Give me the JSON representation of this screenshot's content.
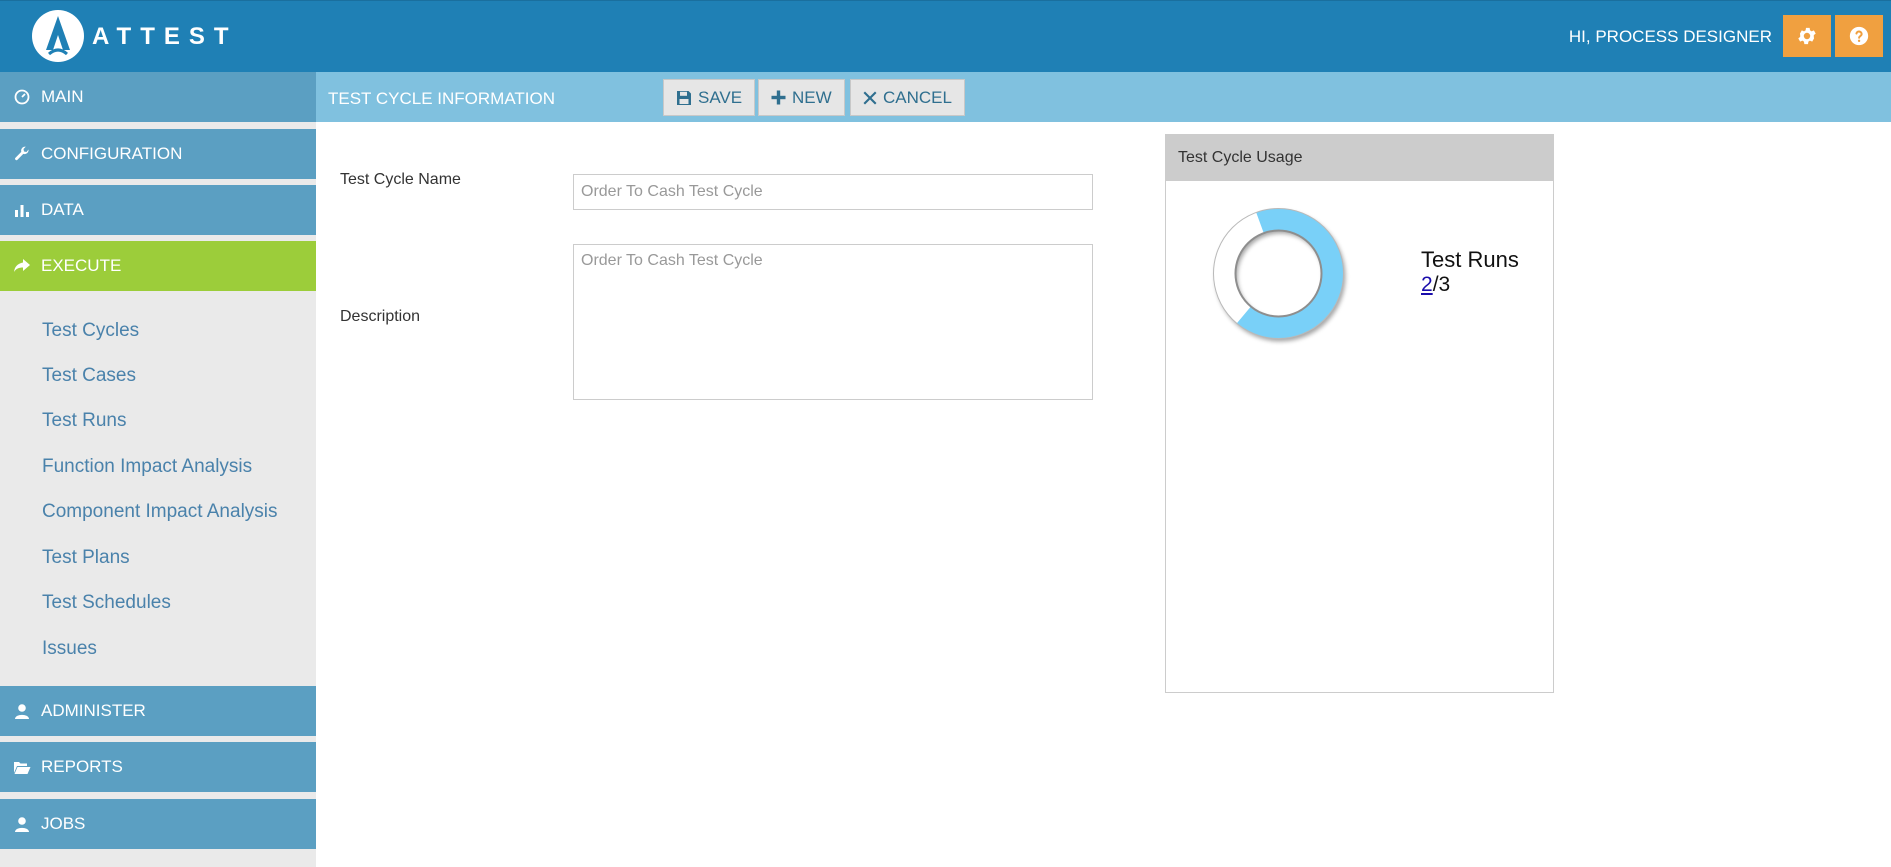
{
  "app": {
    "logo_text": "ATTEST"
  },
  "header": {
    "greeting": "HI, PROCESS DESIGNER"
  },
  "sidebar": {
    "sections": [
      {
        "label": "MAIN",
        "icon": "dashboard-icon"
      },
      {
        "label": "CONFIGURATION",
        "icon": "wrench-icon"
      },
      {
        "label": "DATA",
        "icon": "bar-chart-icon"
      },
      {
        "label": "EXECUTE",
        "icon": "share-arrow-icon",
        "active": true
      },
      {
        "label": "ADMINISTER",
        "icon": "user-icon"
      },
      {
        "label": "REPORTS",
        "icon": "folder-open-icon"
      },
      {
        "label": "JOBS",
        "icon": "user-icon"
      }
    ],
    "execute_items": [
      "Test Cycles",
      "Test Cases",
      "Test Runs",
      "Function Impact Analysis",
      "Component Impact Analysis",
      "Test Plans",
      "Test Schedules",
      "Issues"
    ]
  },
  "toolbar": {
    "title": "TEST CYCLE INFORMATION",
    "save_label": "SAVE",
    "new_label": "NEW",
    "cancel_label": "CANCEL"
  },
  "form": {
    "name_label": "Test Cycle Name",
    "name_placeholder": "Order To Cash Test Cycle",
    "description_label": "Description",
    "description_placeholder": "Order To Cash Test Cycle"
  },
  "usage": {
    "title": "Test Cycle Usage",
    "runs_label": "Test Runs",
    "runs_used": "2",
    "runs_total": "3",
    "fraction_used": 0.6667,
    "fill_color": "#79d0f8",
    "remaining_color": "#ffffff"
  },
  "colors": {
    "topbar": "#1f80b5",
    "nav_section": "#5b9fc2",
    "nav_active": "#9ccd3a",
    "toolbar": "#80c1df",
    "accent_button": "#f0a040"
  }
}
